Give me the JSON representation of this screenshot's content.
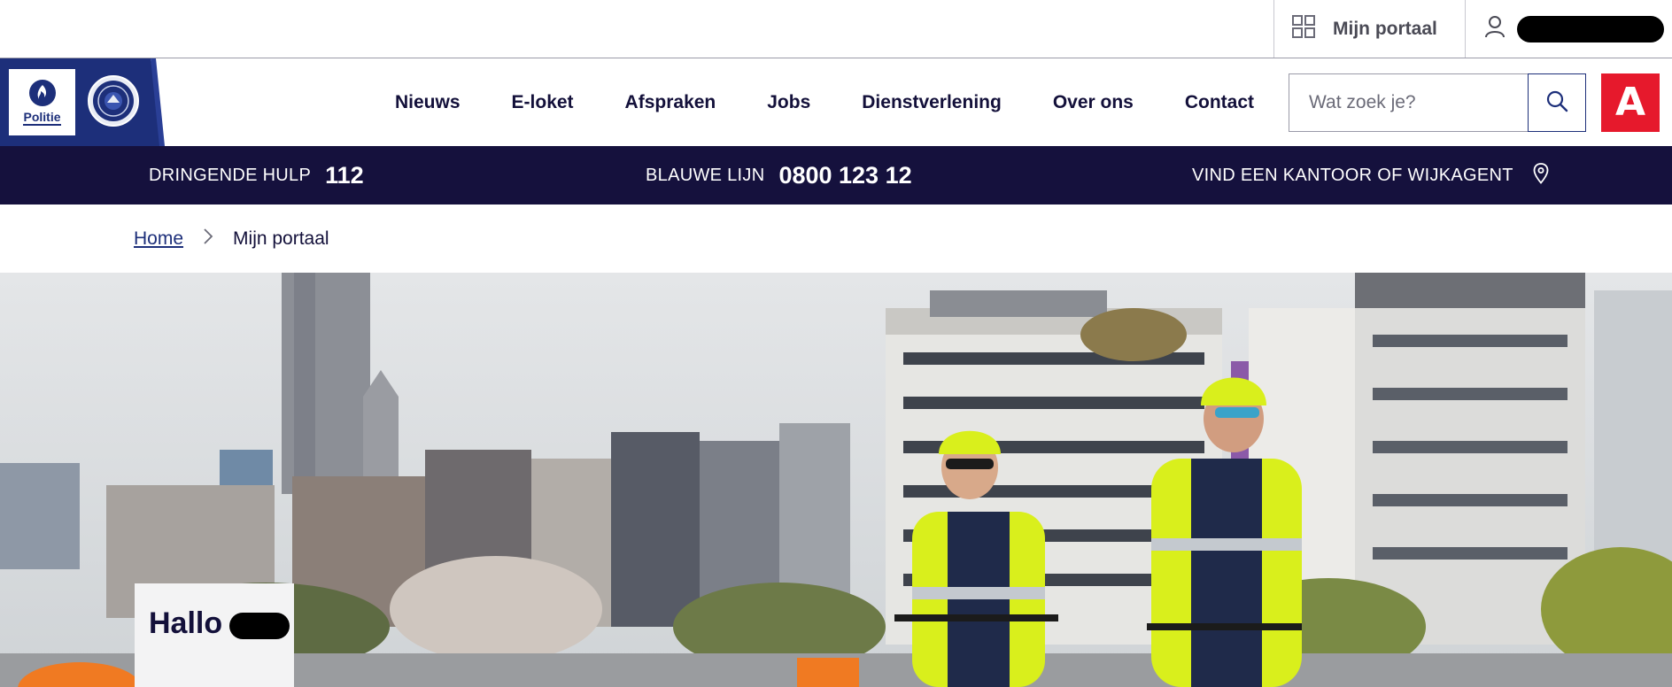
{
  "topbar": {
    "portal_label": "Mijn portaal",
    "portal_icon": "grid-icon",
    "user_icon": "user-icon"
  },
  "nav": {
    "police_logo_label": "Politie",
    "items": [
      "Nieuws",
      "E-loket",
      "Afspraken",
      "Jobs",
      "Dienstverlening",
      "Over ons",
      "Contact"
    ],
    "search_placeholder": "Wat zoek je?",
    "search_icon": "search-icon",
    "city_logo_letter": "A"
  },
  "emergency": {
    "urgent_label": "DRINGENDE HULP",
    "urgent_number": "112",
    "blue_label": "BLAUWE LIJN",
    "blue_number": "0800 123 12",
    "office_label": "VIND EEN KANTOOR OF WIJKAGENT",
    "office_icon": "location-pin-icon"
  },
  "breadcrumb": {
    "home": "Home",
    "current": "Mijn portaal"
  },
  "hero": {
    "greeting": "Hallo"
  },
  "colors": {
    "navy": "#15113d",
    "brand_blue": "#1d2f7a",
    "city_red": "#e6192c",
    "hivis_yellow": "#d9ef1c"
  }
}
